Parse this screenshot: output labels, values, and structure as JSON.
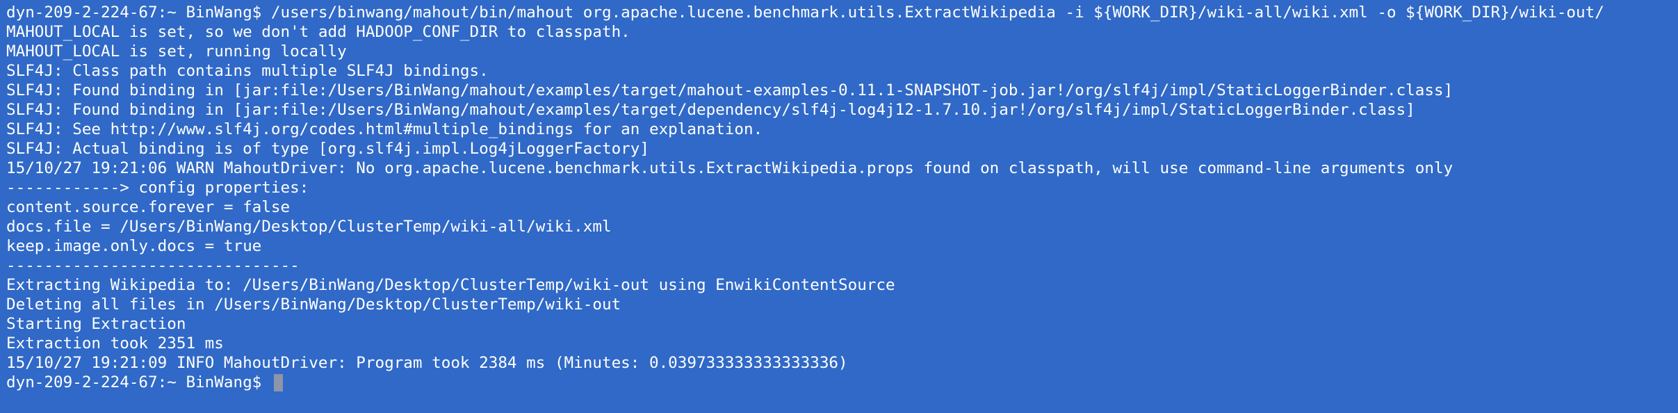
{
  "terminal": {
    "lines": [
      "dyn-209-2-224-67:~ BinWang$ /users/binwang/mahout/bin/mahout org.apache.lucene.benchmark.utils.ExtractWikipedia -i ${WORK_DIR}/wiki-all/wiki.xml -o ${WORK_DIR}/wiki-out/",
      "MAHOUT_LOCAL is set, so we don't add HADOOP_CONF_DIR to classpath.",
      "MAHOUT_LOCAL is set, running locally",
      "SLF4J: Class path contains multiple SLF4J bindings.",
      "SLF4J: Found binding in [jar:file:/Users/BinWang/mahout/examples/target/mahout-examples-0.11.1-SNAPSHOT-job.jar!/org/slf4j/impl/StaticLoggerBinder.class]",
      "SLF4J: Found binding in [jar:file:/Users/BinWang/mahout/examples/target/dependency/slf4j-log4j12-1.7.10.jar!/org/slf4j/impl/StaticLoggerBinder.class]",
      "SLF4J: See http://www.slf4j.org/codes.html#multiple_bindings for an explanation.",
      "SLF4J: Actual binding is of type [org.slf4j.impl.Log4jLoggerFactory]",
      "15/10/27 19:21:06 WARN MahoutDriver: No org.apache.lucene.benchmark.utils.ExtractWikipedia.props found on classpath, will use command-line arguments only",
      "------------> config properties:",
      "content.source.forever = false",
      "docs.file = /Users/BinWang/Desktop/ClusterTemp/wiki-all/wiki.xml",
      "keep.image.only.docs = true",
      "-------------------------------",
      "Extracting Wikipedia to: /Users/BinWang/Desktop/ClusterTemp/wiki-out using EnwikiContentSource",
      "Deleting all files in /Users/BinWang/Desktop/ClusterTemp/wiki-out",
      "Starting Extraction",
      "Extraction took 2351 ms",
      "15/10/27 19:21:09 INFO MahoutDriver: Program took 2384 ms (Minutes: 0.039733333333333336)"
    ],
    "prompt": "dyn-209-2-224-67:~ BinWang$ "
  },
  "colors": {
    "background": "#3069c7",
    "text": "#ffffff",
    "cursor": "#8d95a8"
  }
}
